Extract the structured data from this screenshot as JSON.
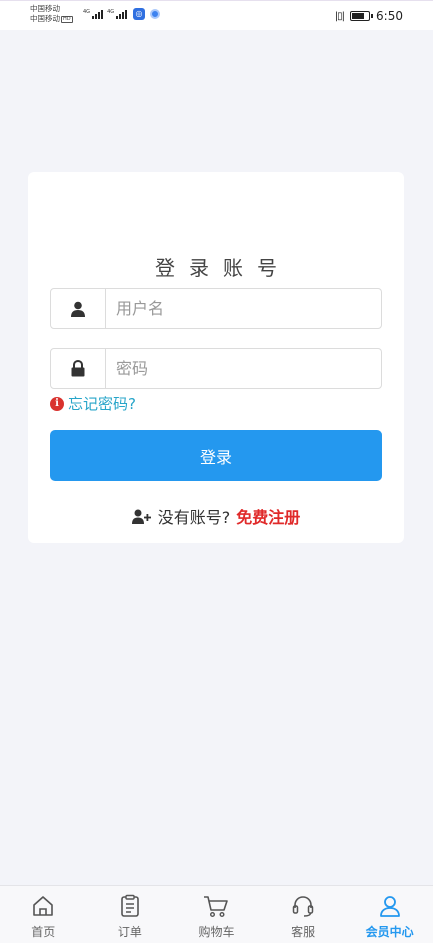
{
  "status_bar": {
    "carrier_line1": "中国移动",
    "carrier_line2": "中国移动",
    "hd_badge": "HD",
    "signal_tag": "4G",
    "vibrate_icon": "vibrate-icon",
    "battery_icon": "battery-icon",
    "time": "6:50"
  },
  "login": {
    "title": "登录账号",
    "username_placeholder": "用户名",
    "password_placeholder": "密码",
    "username_icon": "user-icon",
    "password_icon": "lock-icon",
    "forgot_password": "忘记密码?",
    "forgot_icon": "info-icon",
    "login_button": "登录",
    "no_account_text": "没有账号?",
    "no_account_icon": "user-plus-icon",
    "register_link": "免费注册"
  },
  "bottom_nav": {
    "items": [
      {
        "label": "首页",
        "icon": "home-icon",
        "active": false
      },
      {
        "label": "订单",
        "icon": "order-icon",
        "active": false
      },
      {
        "label": "购物车",
        "icon": "cart-icon",
        "active": false
      },
      {
        "label": "客服",
        "icon": "headset-icon",
        "active": false
      },
      {
        "label": "会员中心",
        "icon": "member-icon",
        "active": true
      }
    ]
  },
  "colors": {
    "primary": "#2498ef",
    "register_link": "#e02a2a",
    "forgot_link": "#27a5c9",
    "background": "#f3f4f9"
  }
}
